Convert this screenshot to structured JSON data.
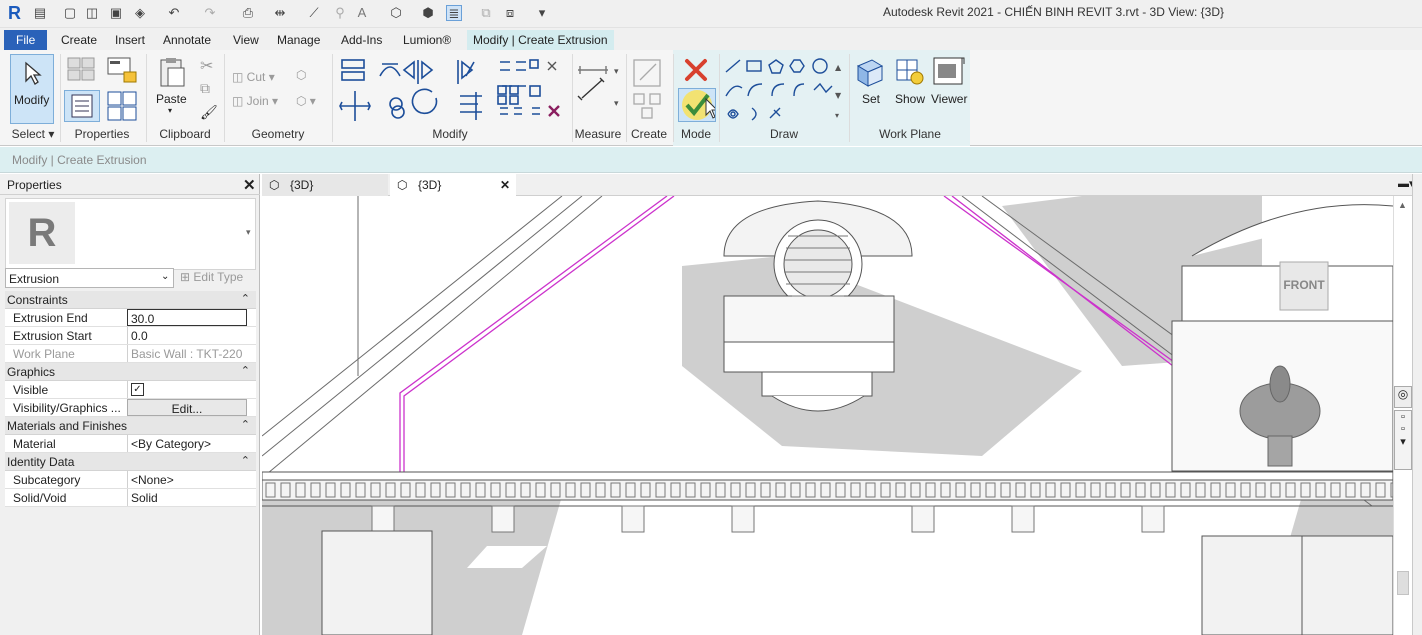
{
  "window": {
    "title": "Autodesk Revit 2021 - CHIẾN BINH REVIT 3.rvt - 3D View: {3D}"
  },
  "ribbon_tabs": [
    "File",
    "Create",
    "Insert",
    "Annotate",
    "View",
    "Manage",
    "Add-Ins",
    "Lumion®",
    "Modify | Create Extrusion"
  ],
  "ribbon": {
    "modify_label": "Modify",
    "paste_label": "Paste",
    "cut_label": "Cut",
    "join_label": "Join",
    "set_label": "Set",
    "show_label": "Show",
    "viewer_label": "Viewer",
    "panels": {
      "select": "Select",
      "properties": "Properties",
      "clipboard": "Clipboard",
      "geometry": "Geometry",
      "modify": "Modify",
      "measure": "Measure",
      "create": "Create",
      "mode": "Mode",
      "draw": "Draw",
      "work_plane": "Work Plane"
    }
  },
  "options_bar": {
    "text": "Modify | Create Extrusion"
  },
  "properties": {
    "title": "Properties",
    "type_selector": "Extrusion",
    "edit_type": "Edit Type",
    "groups": {
      "constraints": "Constraints",
      "graphics": "Graphics",
      "materials": "Materials and Finishes",
      "identity": "Identity Data"
    },
    "rows": {
      "extrusion_end": {
        "label": "Extrusion End",
        "value": "30.0"
      },
      "extrusion_start": {
        "label": "Extrusion Start",
        "value": "0.0"
      },
      "work_plane": {
        "label": "Work Plane",
        "value": "Basic Wall : TKT-220"
      },
      "visible": {
        "label": "Visible",
        "checked": true
      },
      "visibility_graphics": {
        "label": "Visibility/Graphics ...",
        "value": "Edit..."
      },
      "material": {
        "label": "Material",
        "value": "<By Category>"
      },
      "subcategory": {
        "label": "Subcategory",
        "value": "<None>"
      },
      "solid_void": {
        "label": "Solid/Void",
        "value": "Solid"
      }
    }
  },
  "view_tabs": [
    {
      "label": "{3D}",
      "active": false
    },
    {
      "label": "{3D}",
      "active": true
    }
  ],
  "viewcube": {
    "face": "FRONT"
  },
  "colors": {
    "accent": "#2a62b9",
    "context": "#d4ecef",
    "sketch": "#cc33cc"
  }
}
